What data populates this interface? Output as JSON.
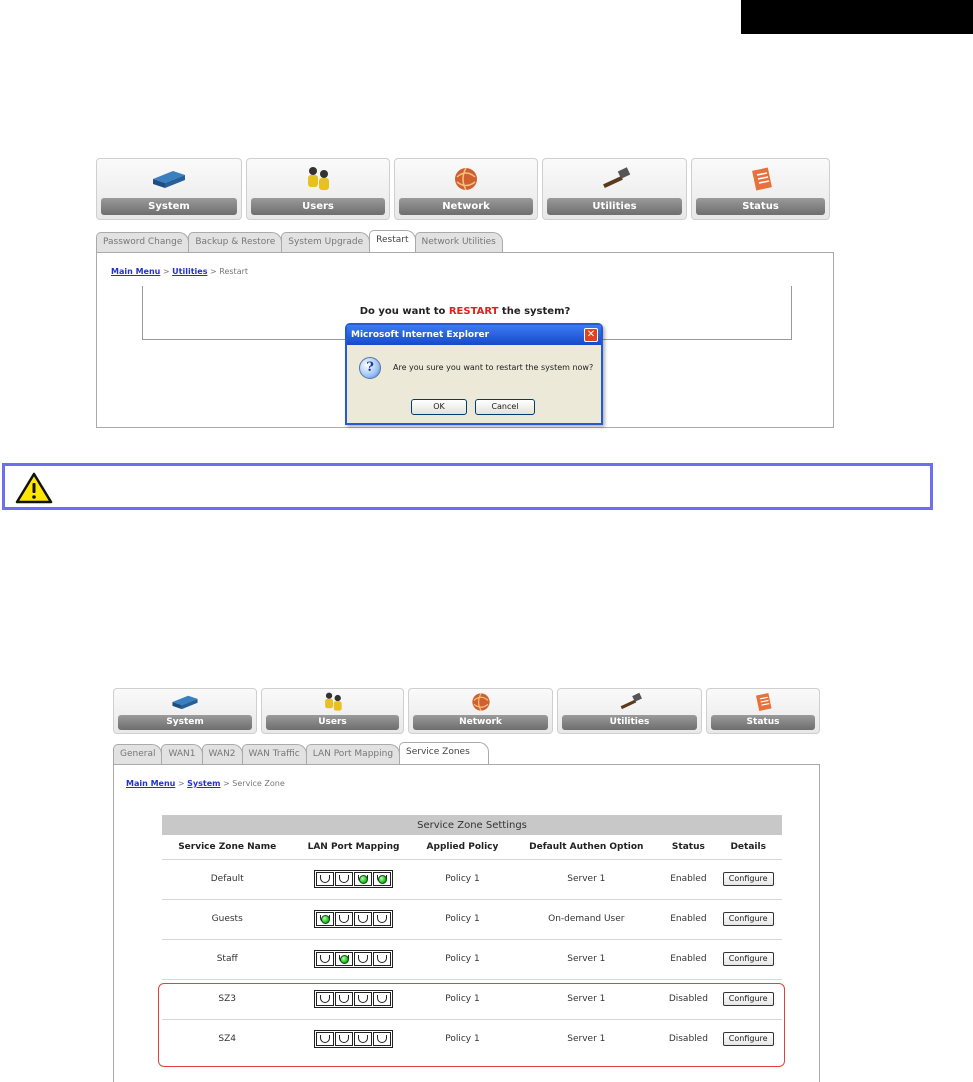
{
  "screenshot1": {
    "nav": [
      "System",
      "Users",
      "Network",
      "Utilities",
      "Status"
    ],
    "tabs": [
      "Password Change",
      "Backup & Restore",
      "System Upgrade",
      "Restart",
      "Network Utilities"
    ],
    "active_tab": "Restart",
    "breadcrumb": {
      "main": "Main Menu",
      "sep1": " > ",
      "section": "Utilities",
      "sep2": " > ",
      "current": "Restart"
    },
    "question": {
      "before": "Do you want to ",
      "highlight": "RESTART",
      "after": " the system?"
    },
    "dialog": {
      "title": "Microsoft Internet Explorer",
      "close": "✕",
      "icon_glyph": "?",
      "message": "Are you sure you want to restart the system now?",
      "ok": "OK",
      "cancel": "Cancel"
    }
  },
  "warning": {
    "icon": "warning-triangle-icon",
    "text": ""
  },
  "screenshot2": {
    "nav": [
      "System",
      "Users",
      "Network",
      "Utilities",
      "Status"
    ],
    "tabs": [
      "General",
      "WAN1",
      "WAN2",
      "WAN Traffic",
      "LAN Port Mapping",
      "Service Zones"
    ],
    "active_tab": "Service Zones",
    "breadcrumb": {
      "main": "Main Menu",
      "sep1": " > ",
      "section": "System",
      "sep2": " > ",
      "current": "Service Zone"
    },
    "table": {
      "caption": "Service Zone Settings",
      "headers": [
        "Service Zone Name",
        "LAN Port Mapping",
        "Applied Policy",
        "Default Authen Option",
        "Status",
        "Details"
      ],
      "rows": [
        {
          "name": "Default",
          "ports": [
            false,
            false,
            true,
            true
          ],
          "policy": "Policy 1",
          "auth": "Server 1",
          "status": "Enabled",
          "details": "Configure"
        },
        {
          "name": "Guests",
          "ports": [
            true,
            false,
            false,
            false
          ],
          "policy": "Policy 1",
          "auth": "On-demand User",
          "status": "Enabled",
          "details": "Configure"
        },
        {
          "name": "Staff",
          "ports": [
            false,
            true,
            false,
            false
          ],
          "policy": "Policy 1",
          "auth": "Server 1",
          "status": "Enabled",
          "details": "Configure"
        },
        {
          "name": "SZ3",
          "ports": [
            false,
            false,
            false,
            false
          ],
          "policy": "Policy 1",
          "auth": "Server 1",
          "status": "Disabled",
          "details": "Configure"
        },
        {
          "name": "SZ4",
          "ports": [
            false,
            false,
            false,
            false
          ],
          "policy": "Policy 1",
          "auth": "Server 1",
          "status": "Disabled",
          "details": "Configure"
        }
      ]
    }
  },
  "colors": {
    "highlight_red": "#e02020",
    "warning_border": "#6e6ef0",
    "dialog_blue": "#2659d6",
    "led_green": "#18b818"
  }
}
